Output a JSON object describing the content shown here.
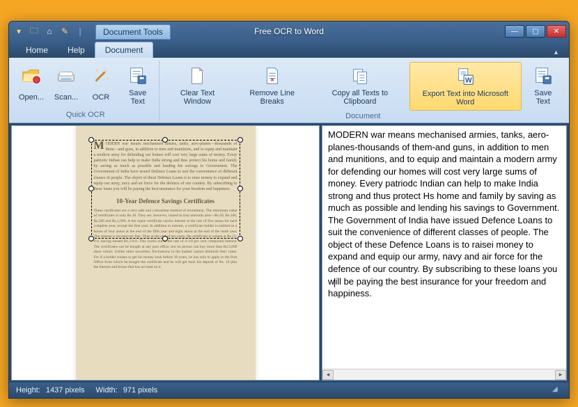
{
  "titlebar": {
    "context_tab": "Document Tools",
    "title": "Free OCR to Word"
  },
  "tabs": {
    "home": "Home",
    "help": "Help",
    "document": "Document"
  },
  "ribbon": {
    "groups": {
      "quick_ocr": {
        "title": "Quick OCR",
        "open": "Open...",
        "scan": "Scan...",
        "ocr": "OCR",
        "save_text": "Save Text"
      },
      "document": {
        "title": "Document",
        "clear_text": "Clear Text Window",
        "remove_breaks": "Remove Line Breaks",
        "copy_clip": "Copy all Texts to Clipboard",
        "export_word": "Export Text into Microsoft Word",
        "save_text": "Save Text"
      }
    }
  },
  "scanned_page": {
    "para1": "MODERN war means mechanised armies, tanks, aero-planes—thousands of them—and guns, in addition to men and munitions, and to equip and maintain a modern army for defending our homes will cost very large sums of money. Every patriotic Indian can help to make India strong and thus protect his home and family by saving as much as possible and lending his savings to Government. The Government of India have issued Defence Loans to suit the convenience of different classes of people. The object of these Defence Loans is to raise money to expand and equip our army, navy and air force for the defence of our country. By subscribing to these loans you will be paying the best insurance for your freedom and happiness.",
    "heading": "10-Year Defence Savings Certificates",
    "para2": "These certificates are a very safe and convenient method of investment. The minimum value of certificates is only Rs.10. They are, however, issued in four amounts also—Rs.50, Rs.100, Rs.500 and Rs.1,000. A ten rupee certificate carries interest at the rate of five annas for each complete year, except the first year. In addition to interest, a certificate holder is entitled to a bonus of four annas at the end of the fifth year and eight annas at the end of the tenth year. The interest is income-tax free. Thus at the end of ten years, the certificate is valued at Rs.13-9-0, having earned Rs.3-9-0. This works out at the rate of 4-1/8 per cent compound interest. The certificates can be bought at any post office, but no person can buy more than Rs.5,000 (face value). Unlike other securities, fluctuations in the market cannot diminish their value. For if a holder wishes to get his money back before 10 years, he has only to apply to the Post Office from which he bought the certificate and he will get back his deposit of Rs. 10 plus the interest and bonus that has accrued on it."
  },
  "ocr_output": {
    "text_before_caret": "MODERN war means mechanised armies, tanks, aero-planes-thousands of them-and guns, in addition to men and munitions, and to equip and maintain a modern army for defending our homes will cost very large sums of money. Every patriodc Indian can help to make India strong and thus protect Hs home and family by saving as much as possible and lending his savings to Government. The Government of India have issued Defence Loans to suit the convenience of different classes of people. The object of these Defence Loans is to raisei money to expand and equip our army, navy and air force for the defence of our country. By subscribing to these loans you w",
    "text_after_caret": "ill be paying the best insurance for your freedom and happiness."
  },
  "statusbar": {
    "height_label": "Height:",
    "height_value": "1437 pixels",
    "width_label": "Width:",
    "width_value": "971 pixels"
  }
}
